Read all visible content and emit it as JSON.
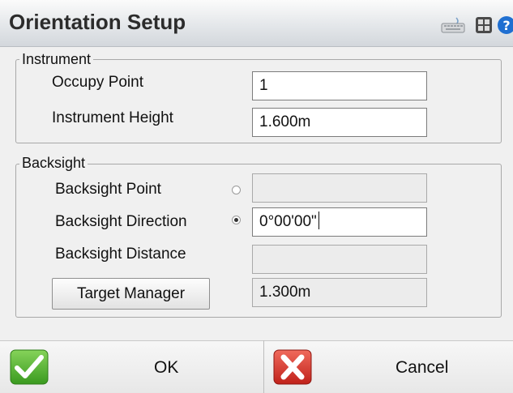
{
  "window": {
    "title": "Orientation Setup"
  },
  "titlebar_icons": [
    "keyboard-icon",
    "settings-grid-icon",
    "help-icon"
  ],
  "instrument": {
    "legend": "Instrument",
    "occupy_point_label": "Occupy Point",
    "occupy_point_value": "1",
    "instrument_height_label": "Instrument Height",
    "instrument_height_value": "1.600m"
  },
  "backsight": {
    "legend": "Backsight",
    "point_label": "Backsight Point",
    "point_value": "",
    "point_selected": false,
    "direction_label": "Backsight Direction",
    "direction_value": "0°00'00\"",
    "direction_selected": true,
    "distance_label": "Backsight Distance",
    "distance_value": "",
    "target_manager_label": "Target Manager",
    "target_height_value": "1.300m"
  },
  "buttons": {
    "ok_label": "OK",
    "cancel_label": "Cancel"
  },
  "colors": {
    "ok_green": "#4caf2a",
    "cancel_red": "#d8322a",
    "help_blue": "#1f6fd1"
  }
}
